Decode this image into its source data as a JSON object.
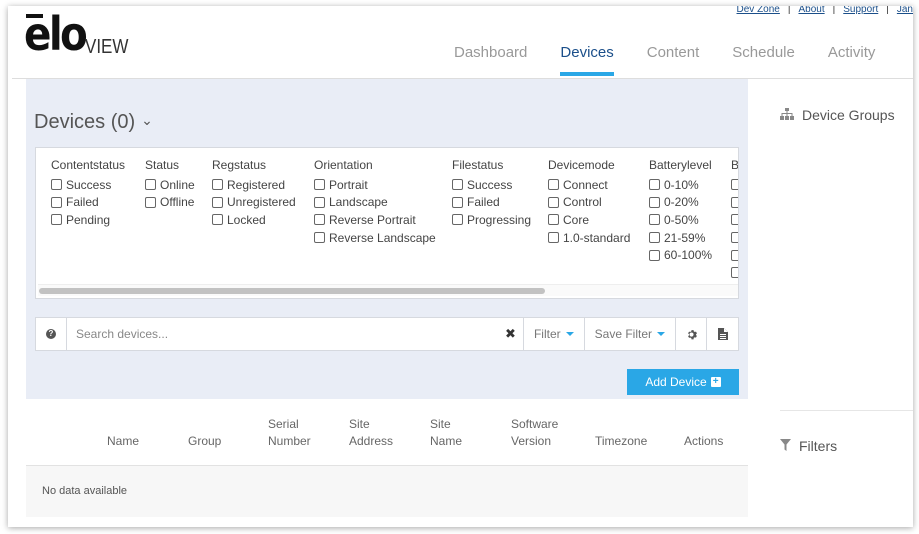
{
  "top_links": [
    "Dev Zone",
    "About",
    "Support",
    "Jan"
  ],
  "logo": {
    "brand": "elo",
    "product": "VIEW"
  },
  "nav": {
    "tabs": [
      {
        "label": "Dashboard",
        "active": false
      },
      {
        "label": "Devices",
        "active": true
      },
      {
        "label": "Content",
        "active": false
      },
      {
        "label": "Schedule",
        "active": false
      },
      {
        "label": "Activity",
        "active": false
      }
    ]
  },
  "devices": {
    "title": "Devices (0)",
    "filters": [
      {
        "header": "Contentstatus",
        "options": [
          "Success",
          "Failed",
          "Pending"
        ]
      },
      {
        "header": "Status",
        "options": [
          "Online",
          "Offline"
        ]
      },
      {
        "header": "Regstatus",
        "options": [
          "Registered",
          "Unregistered",
          "Locked"
        ]
      },
      {
        "header": "Orientation",
        "options": [
          "Portrait",
          "Landscape",
          "Reverse Portrait",
          "Reverse Landscape"
        ]
      },
      {
        "header": "Filestatus",
        "options": [
          "Success",
          "Failed",
          "Progressing"
        ]
      },
      {
        "header": "Devicemode",
        "options": [
          "Connect",
          "Control",
          "Core",
          "1.0-standard"
        ]
      },
      {
        "header": "Batterylevel",
        "options": [
          "0-10%",
          "0-20%",
          "0-50%",
          "21-59%",
          "60-100%"
        ]
      },
      {
        "header": "B",
        "options": [
          "",
          "",
          "",
          "",
          "",
          "",
          ""
        ]
      }
    ],
    "search": {
      "placeholder": "Search devices...",
      "filter_label": "Filter",
      "save_filter_label": "Save Filter"
    },
    "add_button": "Add Device"
  },
  "table": {
    "columns": [
      {
        "line1": "",
        "line2": "Name"
      },
      {
        "line1": "",
        "line2": "Group"
      },
      {
        "line1": "Serial",
        "line2": "Number"
      },
      {
        "line1": "Site",
        "line2": "Address"
      },
      {
        "line1": "Site",
        "line2": "Name"
      },
      {
        "line1": "Software",
        "line2": "Version"
      },
      {
        "line1": "",
        "line2": "Timezone"
      },
      {
        "line1": "",
        "line2": "Actions"
      }
    ],
    "empty_text": "No data available"
  },
  "sidebar": {
    "device_groups": "Device Groups",
    "filters": "Filters"
  },
  "colors": {
    "accent": "#2aa7e6",
    "nav_active": "#1b4f8a",
    "panel_bg": "#e9edf6"
  }
}
